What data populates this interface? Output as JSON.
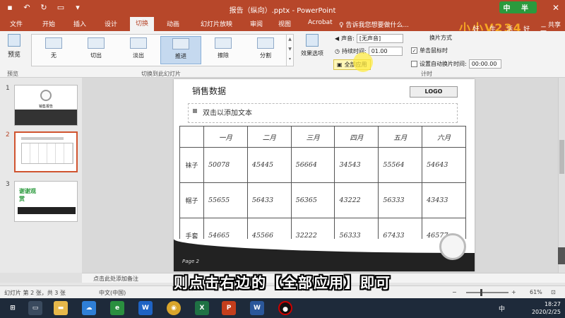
{
  "window": {
    "title": "报告（纵向）.pptx - PowerPoint",
    "brand_badge": "中 半",
    "brand_logo": "小小V234",
    "brand_tagline": "好 生 活 好 二 三 四"
  },
  "tabs": [
    "文件",
    "开始",
    "插入",
    "设计",
    "切换",
    "动画",
    "幻灯片放映",
    "审阅",
    "视图",
    "Acrobat"
  ],
  "active_tab": "切换",
  "tell_me": "♀ 告诉我您想要做什么...",
  "share": "共享",
  "ribbon": {
    "preview_label": "预览",
    "preview_group": "预览",
    "gallery_group": "切换到此幻灯片",
    "transitions": [
      "无",
      "切出",
      "淡出",
      "推进",
      "擦除",
      "分割"
    ],
    "selected_transition": "推进",
    "effect_options": "效果选项",
    "timing_group": "计时",
    "sound_label": "声音:",
    "sound_value": "[无声音]",
    "duration_label": "持续时间:",
    "duration_value": "01.00",
    "apply_all": "全部应用",
    "advance_label": "换片方式",
    "on_click": "单击鼠标时",
    "auto_advance": "设置自动换片时间:",
    "auto_time": "00:00.00"
  },
  "thumbnails": [
    {
      "num": "1",
      "title": "销售报告"
    },
    {
      "num": "2",
      "title": ""
    },
    {
      "num": "3",
      "title": "谢谢观赏"
    }
  ],
  "slide": {
    "title": "销售数据",
    "logo": "LOGO",
    "placeholder": "双击以添加文本",
    "table_headers": [
      "",
      "一月",
      "二月",
      "三月",
      "四月",
      "五月",
      "六月"
    ],
    "table_rows": [
      [
        "袜子",
        "50078",
        "45445",
        "56664",
        "34543",
        "55564",
        "54643"
      ],
      [
        "帽子",
        "55655",
        "56433",
        "56365",
        "43222",
        "56333",
        "43433"
      ],
      [
        "手套",
        "54665",
        "45566",
        "32222",
        "56333",
        "67433",
        "46577"
      ]
    ],
    "page_text": "Page 2"
  },
  "notes_placeholder": "点击此处添加备注",
  "subtitle": "则点击右边的【全部应用】即可",
  "status": {
    "slide_info": "幻灯片 第 2 张，共 3 张",
    "language": "中文(中国)",
    "zoom": "61%"
  },
  "taskbar": {
    "time": "18:27",
    "date": "2020/2/25",
    "ime": "中"
  }
}
